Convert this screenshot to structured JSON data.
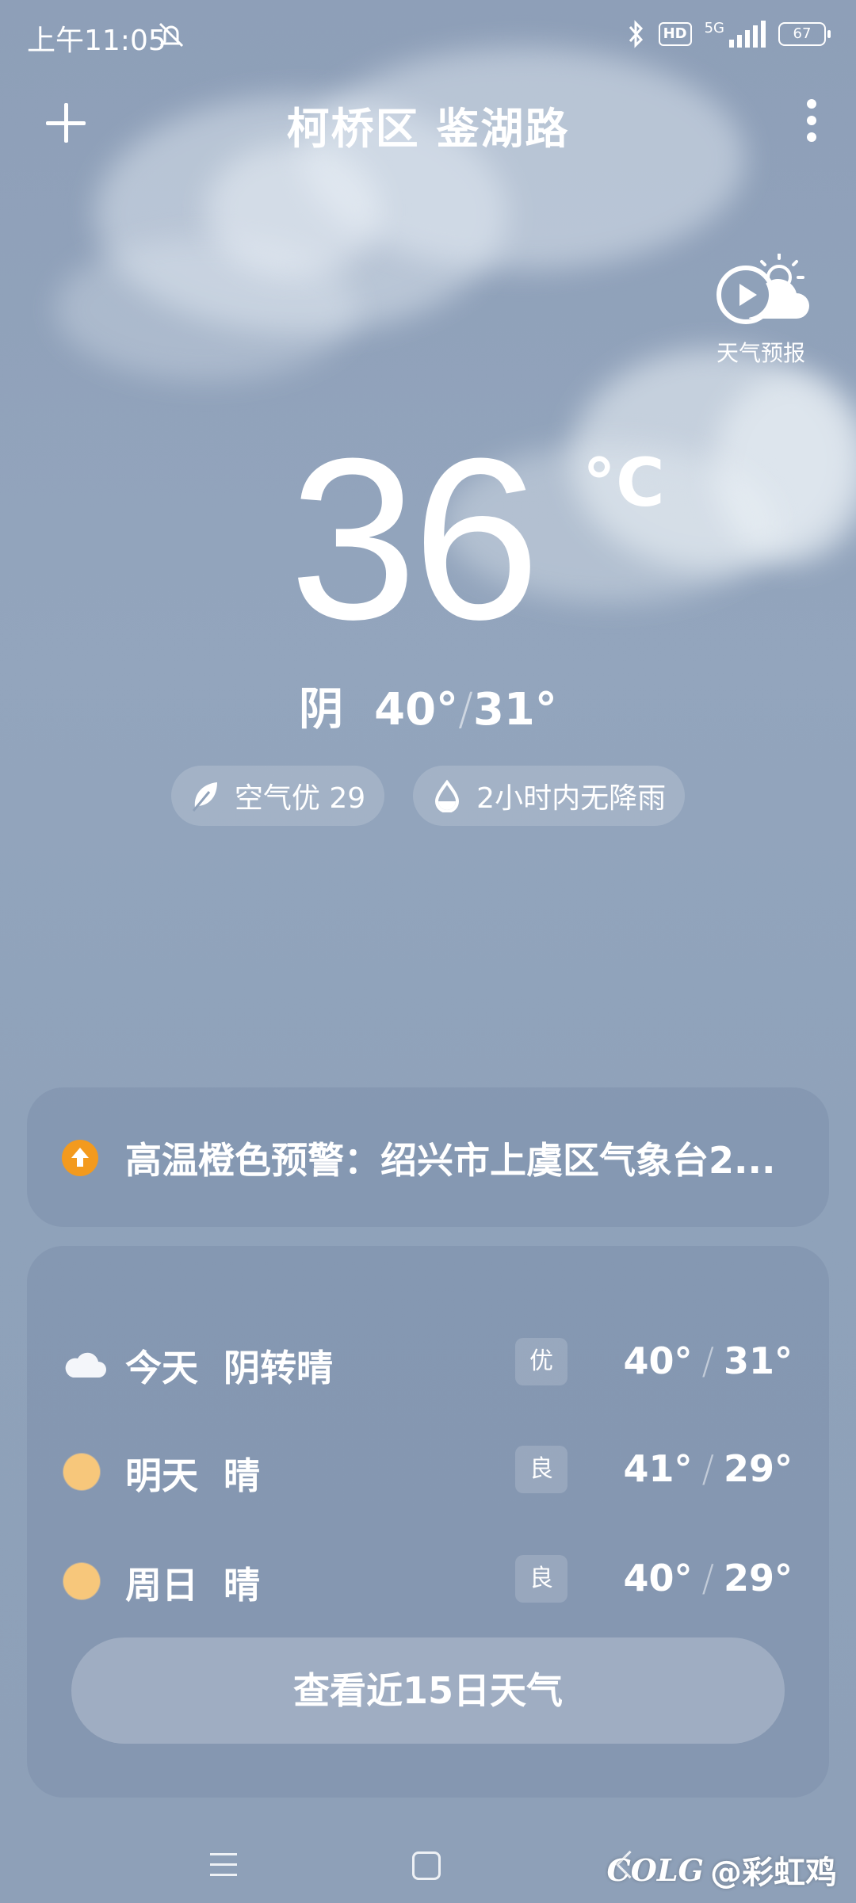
{
  "status_bar": {
    "time": "上午11:05",
    "network": "5G",
    "hd": "HD",
    "battery": "67"
  },
  "header": {
    "location": "柯桥区 鉴湖路"
  },
  "forecast_video": {
    "label": "天气预报"
  },
  "current": {
    "temperature": "36",
    "unit": "°C",
    "condition": "阴",
    "high": "40°",
    "separator": "/",
    "low": "31°"
  },
  "chips": {
    "air": "空气优 29",
    "rain": "2小时内无降雨"
  },
  "alert": {
    "text": "高温橙色预警：绍兴市上虞区气象台2...",
    "color": "#f39a1e"
  },
  "daily": [
    {
      "day": "今天",
      "condition": "阴转晴",
      "icon": "cloud-icon",
      "aqi": "优",
      "high": "40°",
      "low": "31°"
    },
    {
      "day": "明天",
      "condition": "晴",
      "icon": "sun-icon",
      "aqi": "良",
      "high": "41°",
      "low": "29°"
    },
    {
      "day": "周日",
      "condition": "晴",
      "icon": "sun-icon",
      "aqi": "良",
      "high": "40°",
      "low": "29°"
    }
  ],
  "slash": "/",
  "more_button": "查看近15日天气",
  "watermark": {
    "logo": "COLG",
    "user": "@彩虹鸡"
  }
}
